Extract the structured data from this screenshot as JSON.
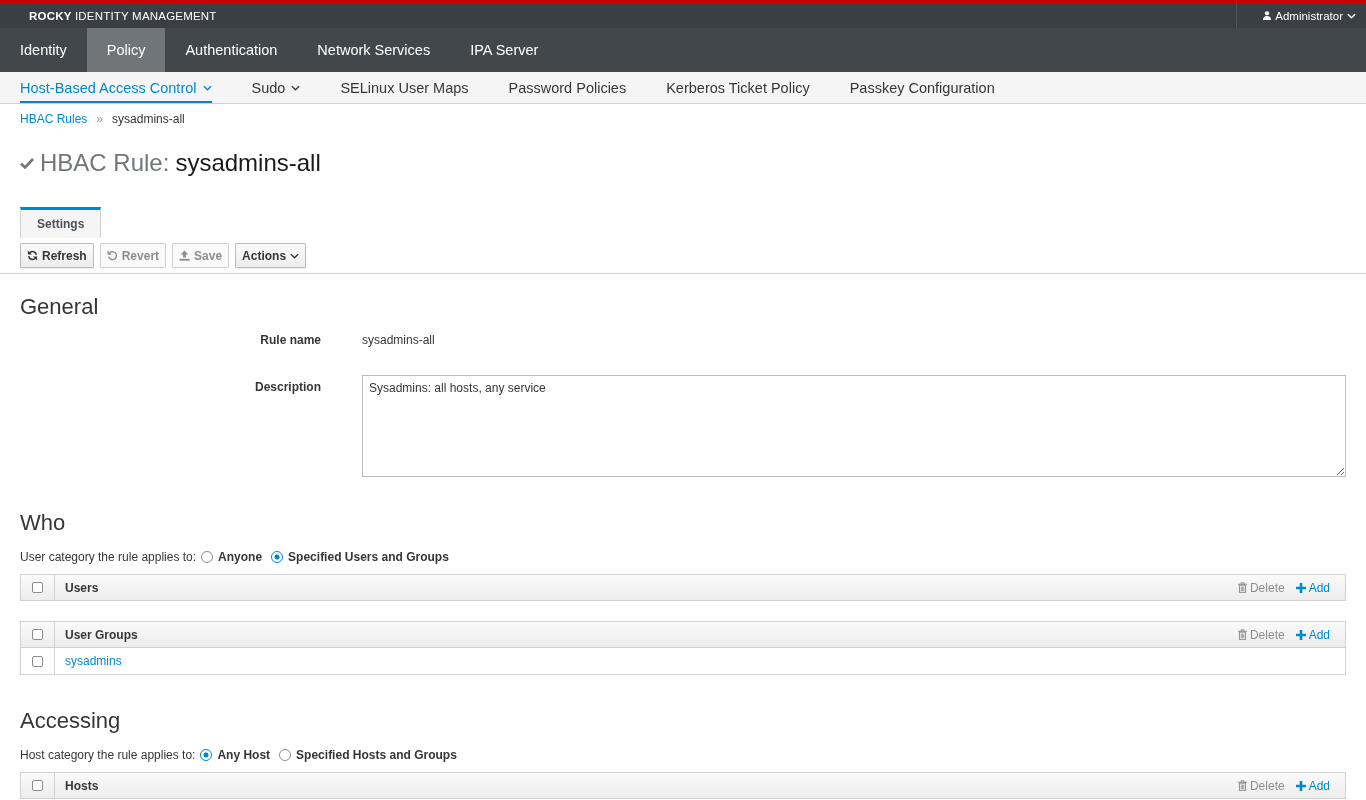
{
  "masthead": {
    "brand": "**ROCKY** IDENTITY MANAGEMENT",
    "user": "Administrator"
  },
  "main_nav": [
    {
      "label": "Identity",
      "selected": false
    },
    {
      "label": "Policy",
      "selected": true
    },
    {
      "label": "Authentication",
      "selected": false
    },
    {
      "label": "Network Services",
      "selected": false
    },
    {
      "label": "IPA Server",
      "selected": false
    }
  ],
  "sub_nav": [
    {
      "label": "Host-Based Access Control",
      "selected": true,
      "dropdown": true
    },
    {
      "label": "Sudo",
      "selected": false,
      "dropdown": true
    },
    {
      "label": "SELinux User Maps",
      "selected": false,
      "dropdown": false
    },
    {
      "label": "Password Policies",
      "selected": false,
      "dropdown": false
    },
    {
      "label": "Kerberos Ticket Policy",
      "selected": false,
      "dropdown": false
    },
    {
      "label": "Passkey Configuration",
      "selected": false,
      "dropdown": false
    }
  ],
  "breadcrumb": {
    "parent": "HBAC Rules",
    "separator": "»",
    "current": "sysadmins-all"
  },
  "page_title": {
    "type_label": "HBAC Rule:",
    "name": "sysadmins-all"
  },
  "tabs": [
    {
      "label": "Settings",
      "selected": true
    }
  ],
  "toolbar": [
    {
      "kind": "refresh",
      "label": "Refresh",
      "disabled": false
    },
    {
      "kind": "revert",
      "label": "Revert",
      "disabled": true
    },
    {
      "kind": "save",
      "label": "Save",
      "disabled": true
    },
    {
      "kind": "menu",
      "label": "Actions",
      "disabled": false
    }
  ],
  "sections": [
    {
      "kind": "form",
      "title": "General",
      "fields": [
        {
          "kind": "text",
          "label": "Rule name",
          "value": "sysadmins-all"
        },
        {
          "kind": "textarea",
          "label": "Description",
          "value": "Sysadmins: all hosts, any service"
        }
      ]
    },
    {
      "kind": "category",
      "title": "Who",
      "category_label": "User category the rule applies to:",
      "options": [
        {
          "label": "Anyone",
          "selected": false
        },
        {
          "label": "Specified Users and Groups",
          "selected": true
        }
      ],
      "tables": [
        {
          "title": "Users",
          "checked": false,
          "delete": {
            "label": "Delete",
            "disabled": true
          },
          "add": "Add"
        },
        {
          "title": "User Groups",
          "checked": false,
          "delete": {
            "label": "Delete",
            "disabled": true
          },
          "add": "Add",
          "rows": [
            {
              "name": "sysadmins",
              "checked": false
            }
          ]
        }
      ]
    },
    {
      "kind": "category",
      "title": "Accessing",
      "category_label": "Host category the rule applies to:",
      "options": [
        {
          "label": "Any Host",
          "selected": true
        },
        {
          "label": "Specified Hosts and Groups",
          "selected": false
        }
      ],
      "tables": [
        {
          "title": "Hosts",
          "checked": false,
          "delete": {
            "label": "Delete",
            "disabled": true
          },
          "add": "Add"
        }
      ]
    }
  ]
}
